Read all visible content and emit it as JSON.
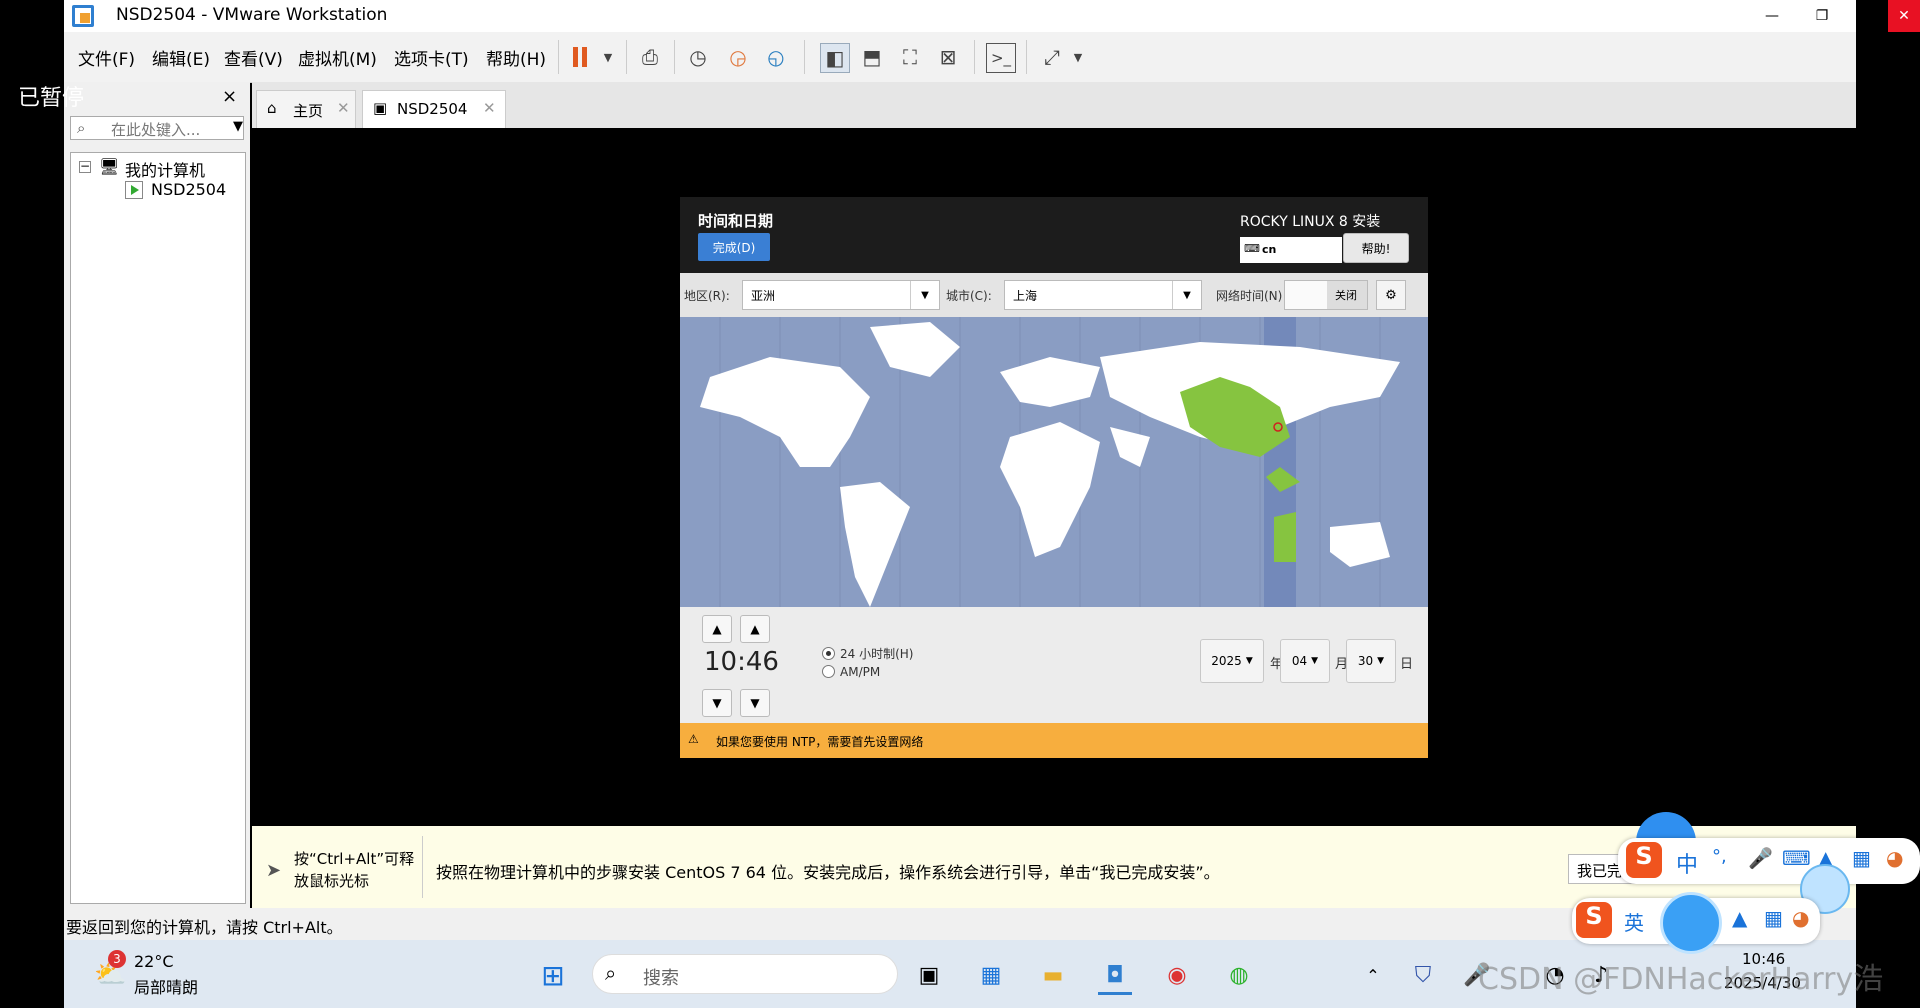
{
  "window": {
    "title": "NSD2504 - VMware Workstation",
    "min": "—",
    "max": "❐",
    "close": "✕"
  },
  "menu": [
    "文件(F)",
    "编辑(E)",
    "查看(V)",
    "虚拟机(M)",
    "选项卡(T)",
    "帮助(H)"
  ],
  "overlay": {
    "paused": "已暂停"
  },
  "library": {
    "close": "×",
    "search_placeholder": "在此处键入...",
    "tree": {
      "root": "我的计算机",
      "child": "NSD2504"
    }
  },
  "tabs": [
    {
      "label": "主页"
    },
    {
      "label": "NSD2504"
    }
  ],
  "installer": {
    "title": "时间和日期",
    "done": "完成(D)",
    "product": "ROCKY LINUX 8 安装",
    "keyboard": "cn",
    "help": "帮助!",
    "region_label": "地区(R):",
    "region_value": "亚洲",
    "city_label": "城市(C):",
    "city_value": "上海",
    "network_time_label": "网络时间(N)",
    "network_toggle": "关闭",
    "time": "10:46",
    "format_24h": "24 小时制(H)",
    "format_ampm": "AM/PM",
    "year": "2025",
    "year_unit": "年",
    "month": "04",
    "month_unit": "月",
    "day": "30",
    "day_unit": "日",
    "warning": "如果您要使用 NTP，需要首先设置网络"
  },
  "hint": {
    "short_line1": "按“Ctrl+Alt”可释",
    "short_line2": "放鼠标光标",
    "long": "按照在物理计算机中的步骤安装 CentOS 7 64 位。安装完成后，操作系统会进行引导，单击“我已完成安装”。",
    "finish_button": "我已完"
  },
  "status": {
    "text": "要返回到您的计算机，请按 Ctrl+Alt。"
  },
  "taskbar": {
    "weather_badge": "3",
    "temp": "22°C",
    "weather": "局部晴朗",
    "search": "搜索",
    "time": "10:46",
    "date": "2025/4/30"
  },
  "ime": {
    "zh": "中",
    "en": "英",
    "punct": "°,"
  },
  "watermark": "CSDN @FDNHackerHarry浩"
}
